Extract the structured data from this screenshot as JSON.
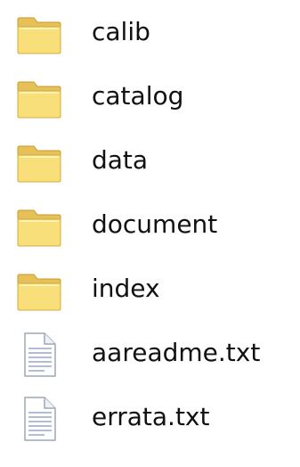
{
  "file_list": {
    "items": [
      {
        "name": "calib",
        "type": "folder",
        "icon": "folder-icon"
      },
      {
        "name": "catalog",
        "type": "folder",
        "icon": "folder-icon"
      },
      {
        "name": "data",
        "type": "folder",
        "icon": "folder-icon"
      },
      {
        "name": "document",
        "type": "folder",
        "icon": "folder-icon"
      },
      {
        "name": "index",
        "type": "folder",
        "icon": "folder-icon"
      },
      {
        "name": "aareadme.txt",
        "type": "file",
        "icon": "text-file-icon"
      },
      {
        "name": "errata.txt",
        "type": "file",
        "icon": "text-file-icon"
      }
    ]
  },
  "colors": {
    "text": "#111111",
    "folder_light": "#f8df7a",
    "folder_dark": "#e0b84a",
    "document_lines": "#9aa9c9"
  }
}
